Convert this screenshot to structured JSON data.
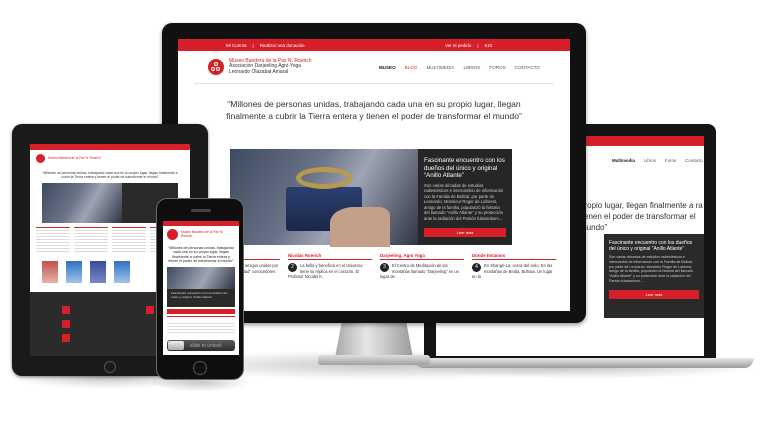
{
  "imac": {
    "topbar": {
      "left_links": [
        "Mi Cuenta",
        "Realizar una donación"
      ],
      "right_links": [
        "Ver el pedido",
        "€10"
      ]
    },
    "logo": {
      "line1": "Museo Bandera de la Paz N. Roerich",
      "line2": "Asociación Darjeeling Agni-Yoga",
      "line3": "Leonardo Olazabal Amaral"
    },
    "nav": [
      "Museo",
      "Blog",
      "Multimedia",
      "Libros",
      "Foros",
      "Contacto"
    ],
    "quote": "“Millones de personas unidas, trabajando cada una en su propio lugar, llegan finalmente a cubrir la Tierra entera y tienen el poder de transformar el mundo”",
    "hero": {
      "title": "Fascinante encuentro con los dueños del único y original “Anillo Atlante”",
      "body": "Son varias décadas de estudios radiestésicos e intercambio de información con la Familia de Belizal, por parte de Leonardo. Monsieur Roger de Laforest, amigo de la familia, popularizó la historia del llamado “Anillo Atlante” y su protección ante la radiación del Parsón fulanankom...",
      "button": "Leer más"
    },
    "columns": [
      {
        "title": "Quienes Somos",
        "number": "1",
        "text": "Somos un grupo de amigos unidos por el “espíritu de voluntad” conocedores del"
      },
      {
        "title": "Nicolás Roerich",
        "number": "2",
        "text": "La bella y beneficio en el Universo: tiene su réplica en el corazón. El Profesor Nicolás K."
      },
      {
        "title": "Darjeeling, Agni Yoga",
        "number": "3",
        "text": "El Centro de Meditación de las montañas llamado “Darjeeling” es un lugar de"
      },
      {
        "title": "Dónde Estamos",
        "number": "4",
        "text": "En Shangri-La, cerca del cielo. En las montañas de Bedia, Bizkaia. Un lugar en la"
      }
    ]
  },
  "laptop": {
    "topbar": [
      "Ver el pedido",
      "€10"
    ],
    "nav": [
      "Multimedia",
      "Libros",
      "Foros",
      "Contacto"
    ],
    "quote": "propio lugar, llegan finalmente a ra y tienen el poder de transformar el mundo”",
    "hero": {
      "title": "Fascinante encuentro con los dueños del único y original “Anillo Atlante”",
      "body": "Son varias décadas de estudios radiestésicos e intercambio de información con la Familia de Belizal, por parte de Leonardo. Monsieur Roger de Laforest, amigo de la familia, popularizó la historia del llamado “Anillo Atlante” y su protección ante la radiación del Parsón fulanankom...",
      "button": "Leer más"
    }
  },
  "tablet": {
    "logo": "Museo Bandera de la Paz N. Roerich",
    "quote": "“Millones de personas unidas, trabajando cada una en su propio lugar, llegan finalmente a cubrir la Tierra entera y tienen el poder de transformar el mundo”"
  },
  "phone": {
    "logo": "Museo Bandera de la Paz N. Roerich",
    "quote": "“Millones de personas unidas, trabajando cada una en su propio lugar, llegan finalmente a cubrir la Tierra entera y tienen el poder de transformar el mundo”",
    "hero_text": "Fascinante encuentro con los dueños del único y original “Anillo Atlante”",
    "slide_label": "slide to unlock"
  },
  "colors": {
    "brand_red": "#d71f2a",
    "dark_panel": "#2a2a2a",
    "device_black": "#111111"
  }
}
